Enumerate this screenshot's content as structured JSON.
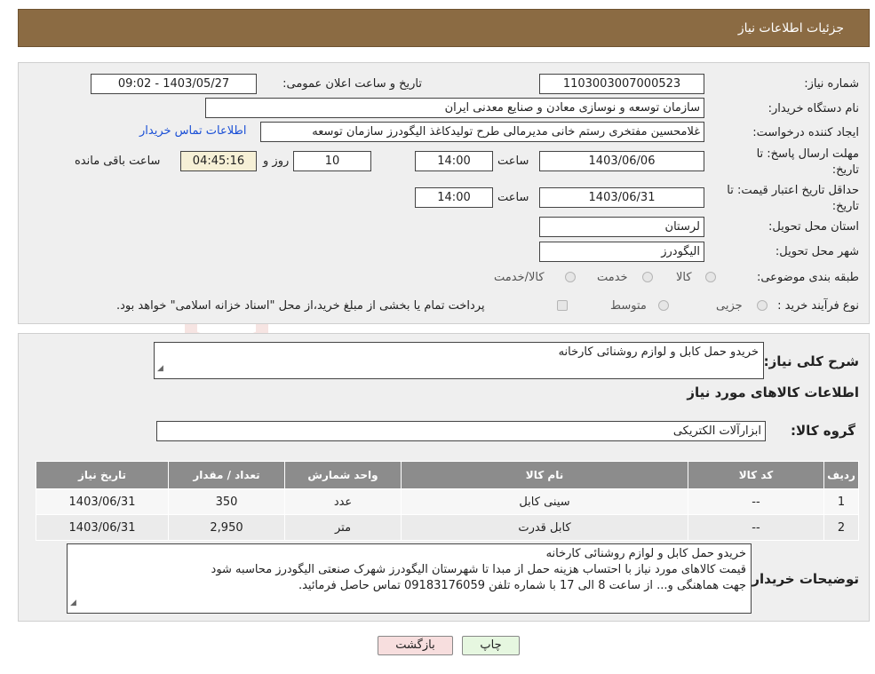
{
  "header": {
    "title": "جزئیات اطلاعات نیاز"
  },
  "form": {
    "need_number_label": "شماره نیاز:",
    "need_number": "1103003007000523",
    "announce_label": "تاریخ و ساعت اعلان عمومی:",
    "announce_value": "1403/05/27 - 09:02",
    "buyer_org_label": "نام دستگاه خریدار:",
    "buyer_org": "سازمان توسعه و نوسازی معادن و صنایع معدنی ایران",
    "requester_label": "ایجاد کننده درخواست:",
    "requester": "غلامحسین مفتخری رستم خانی مدیرمالی طرح تولیدکاغذ الیگودرز سازمان توسعه",
    "contact_link": "اطلاعات تماس خریدار",
    "deadline_label_1": "مهلت ارسال پاسخ: تا",
    "deadline_label_2": "تاریخ:",
    "deadline_date": "1403/06/06",
    "time_label": "ساعت",
    "deadline_time": "14:00",
    "days_value": "10",
    "days_label": "روز و",
    "remaining_time": "04:45:16",
    "remaining_label": "ساعت باقی مانده",
    "validity_label_1": "حداقل تاریخ اعتبار قیمت: تا",
    "validity_label_2": "تاریخ:",
    "validity_date": "1403/06/31",
    "validity_time": "14:00",
    "province_label": "استان محل تحویل:",
    "province": "لرستان",
    "city_label": "شهر محل تحویل:",
    "city": "الیگودرز",
    "category_label": "طبقه بندی موضوعی:",
    "category_options": [
      "کالا",
      "خدمت",
      "کالا/خدمت"
    ],
    "process_label": "نوع فرآیند خرید :",
    "process_options": [
      "جزیی",
      "متوسط"
    ],
    "process_note": "پرداخت تمام یا بخشی از مبلغ خرید،از محل \"اسناد خزانه اسلامی\" خواهد بود."
  },
  "summary": {
    "label": "شرح کلی نیاز:",
    "value": "خریدو حمل کابل و لوازم روشنائی کارخانه",
    "goods_info_title": "اطلاعات کالاهای مورد نیاز",
    "group_label": "گروه کالا:",
    "group_value": "ابزارآلات الکتریکی"
  },
  "table": {
    "headers": [
      "ردیف",
      "کد کالا",
      "نام کالا",
      "واحد شمارش",
      "تعداد / مقدار",
      "تاریخ نیاز"
    ],
    "rows": [
      [
        "1",
        "--",
        "سینی کابل",
        "عدد",
        "350",
        "1403/06/31"
      ],
      [
        "2",
        "--",
        "کابل قدرت",
        "متر",
        "2,950",
        "1403/06/31"
      ]
    ]
  },
  "buyer_notes": {
    "label": "توضیحات خریدار:",
    "lines": [
      "خریدو حمل کابل و لوازم روشنائی کارخانه",
      "قیمت کالاهای مورد نیاز با احتساب هزینه حمل از مبدا تا شهرستان الیگودرز شهرک صنعتی الیگودرز محاسبه شود",
      "جهت هماهنگی و... از ساعت 8 الی 17 با شماره تلفن 09183176059 تماس حاصل فرمائید."
    ]
  },
  "buttons": {
    "print": "چاپ",
    "back": "بازگشت"
  },
  "watermark": {
    "text": "AriaTender.neT"
  },
  "colors": {
    "header_bg": "#8b6b43",
    "panel_bg": "#efefef",
    "table_header": "#8c8c8c",
    "back_btn": "#f7dede",
    "print_btn": "#e6f7e0"
  }
}
